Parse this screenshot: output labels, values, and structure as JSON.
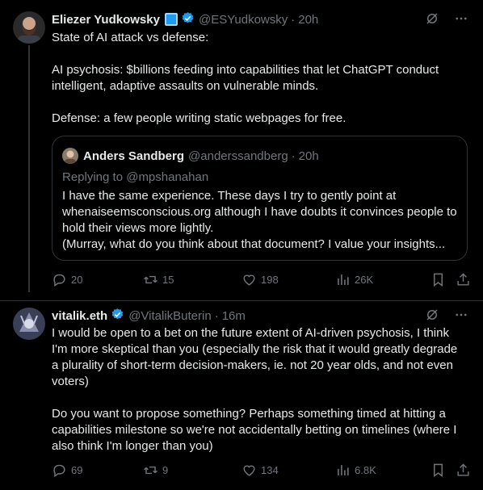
{
  "post1": {
    "author": "Eliezer Yudkowsky",
    "handle": "@ESYudkowsky",
    "sep": "·",
    "time": "20h",
    "text": "State of AI attack vs defense:\n\nAI psychosis: $billions feeding into capabilities that let ChatGPT conduct intelligent, adaptive assaults on vulnerable minds.\n\nDefense: a few people writing static webpages for free.",
    "quote": {
      "author": "Anders Sandberg",
      "handle": "@anderssandberg",
      "sep": "·",
      "time": "20h",
      "replying": "Replying to @mpshanahan",
      "text": "I have the same experience. These days I try to gently point at whenaiseemsconscious.org although I have doubts it convinces people to hold their views more lightly.\n(Murray, what do you think about that document? I value your insights..."
    },
    "actions": {
      "replies": "20",
      "reposts": "15",
      "likes": "198",
      "views": "26K"
    }
  },
  "post2": {
    "author": "vitalik.eth",
    "handle": "@VitalikButerin",
    "sep": "·",
    "time": "16m",
    "text": "I would be open to a bet on the future extent of AI-driven psychosis, I think I'm more skeptical than you (especially the risk that it would greatly degrade a plurality of short-term decision-makers, ie. not 20 year olds, and not even voters)\n\nDo you want to propose something? Perhaps something timed at hitting a capabilities milestone so we're not accidentally betting on timelines (where I also think I'm longer than you)",
    "actions": {
      "replies": "69",
      "reposts": "9",
      "likes": "134",
      "views": "6.8K"
    }
  },
  "icons": {
    "verified": "verified-badge-icon",
    "grok": "grok-icon",
    "more": "more-icon",
    "reply": "reply-icon",
    "repost": "repost-icon",
    "like": "like-icon",
    "views": "views-icon",
    "bookmark": "bookmark-icon",
    "share": "share-icon"
  },
  "colors": {
    "background": "#000000",
    "text": "#e7e9ea",
    "muted": "#71767b",
    "verified": "#1d9bf0",
    "border": "#2f3336"
  }
}
